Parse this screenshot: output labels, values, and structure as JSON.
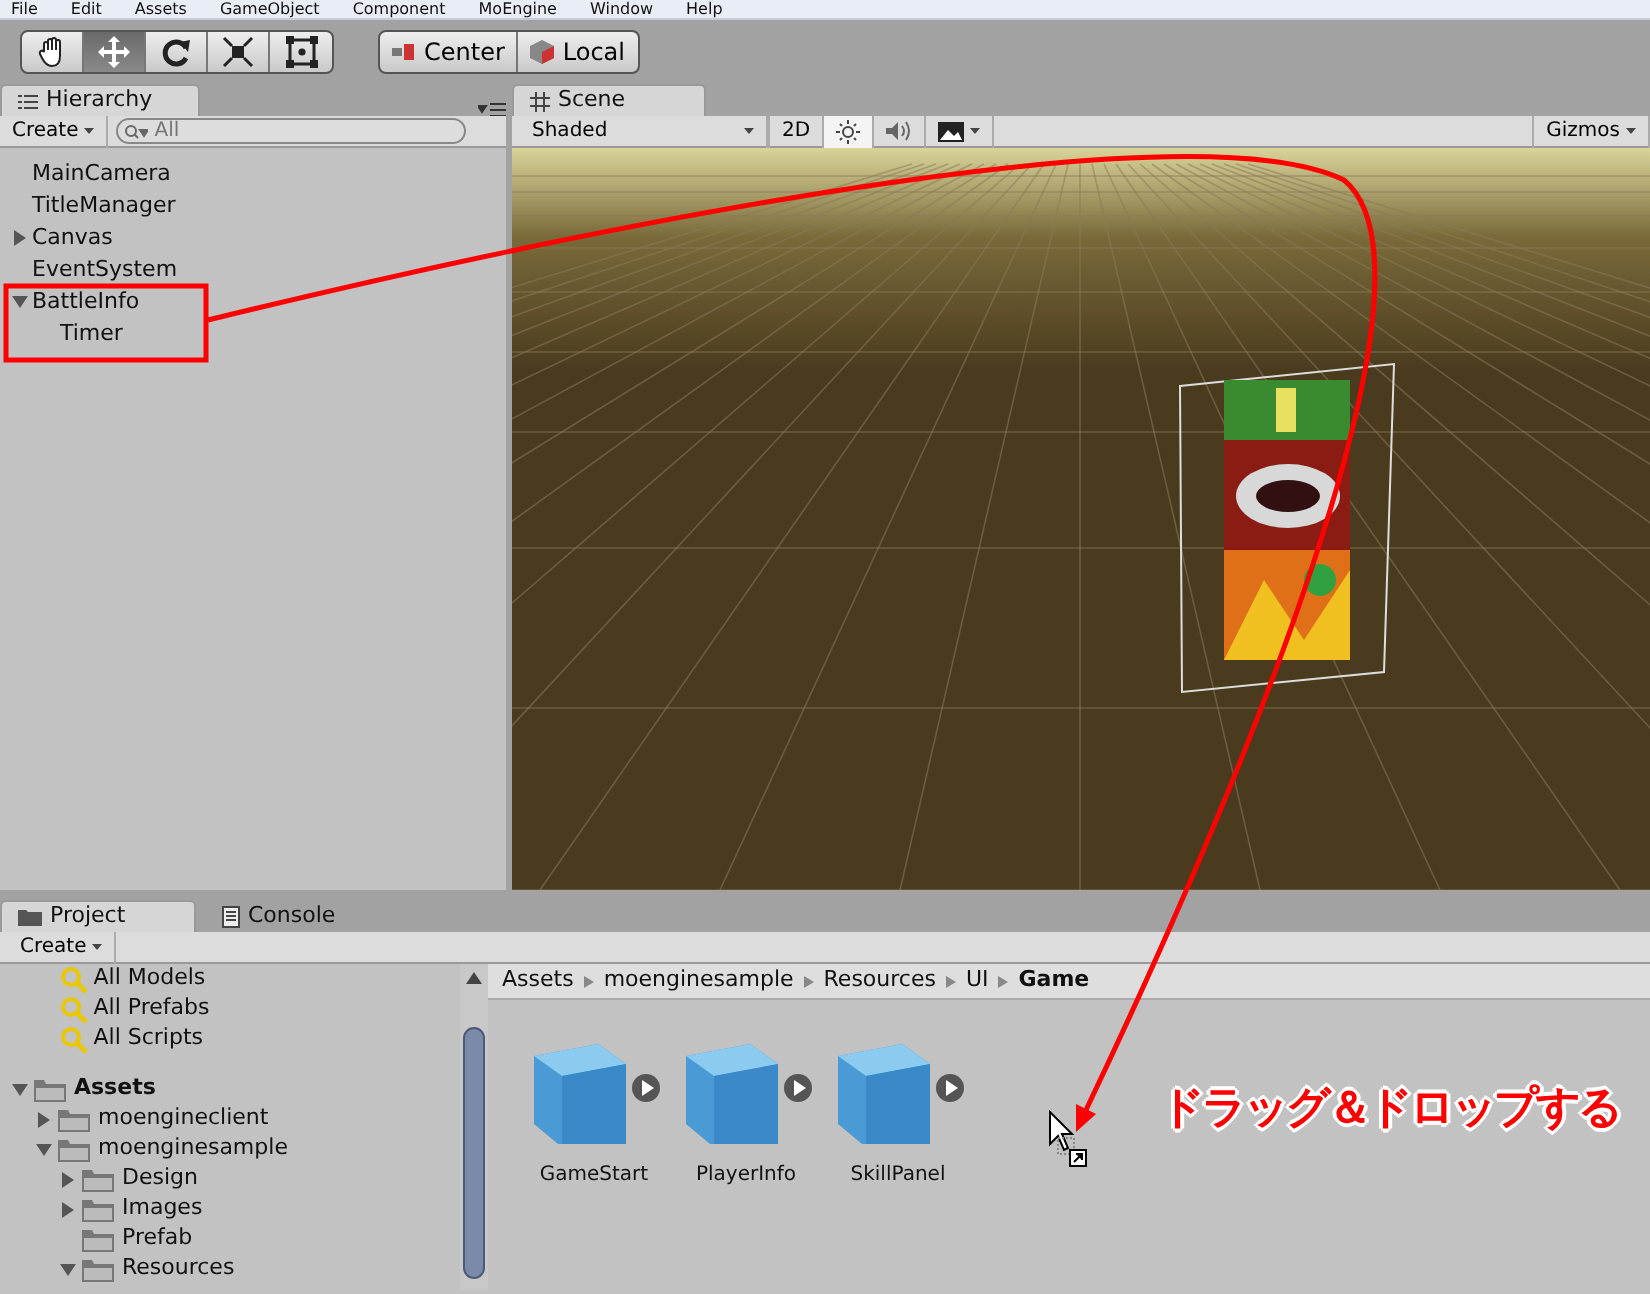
{
  "menu_bar": [
    "File",
    "Edit",
    "Assets",
    "GameObject",
    "Component",
    "MoEngine",
    "Window",
    "Help"
  ],
  "toolbar": {
    "tools": [
      {
        "kind": "hand",
        "selected": false
      },
      {
        "kind": "move",
        "selected": true
      },
      {
        "kind": "rotate",
        "selected": false
      },
      {
        "kind": "scale",
        "selected": false
      },
      {
        "kind": "rect",
        "selected": false
      }
    ],
    "pivot_buttons": [
      {
        "kind": "center",
        "label": "Center"
      },
      {
        "kind": "local",
        "label": "Local"
      }
    ]
  },
  "hierarchy": {
    "tab": "Hierarchy",
    "create": "Create",
    "search": {
      "placeholder": "All"
    },
    "items": [
      {
        "kind": "leaf",
        "label": "MainCamera"
      },
      {
        "kind": "leaf",
        "label": "TitleManager"
      },
      {
        "kind": "group",
        "label": "Canvas",
        "expanded": false
      },
      {
        "kind": "leaf",
        "label": "EventSystem"
      },
      {
        "kind": "group",
        "label": "BattleInfo",
        "expanded": true,
        "children": [
          {
            "kind": "leaf",
            "label": "Timer"
          }
        ]
      }
    ]
  },
  "scene": {
    "tab": "Scene",
    "shading": "Shaded",
    "mode_2d": "2D",
    "lighting_on": true,
    "audio_on": false,
    "gizmos": "Gizmos"
  },
  "project": {
    "tabs": [
      {
        "kind": "project",
        "label": "Project",
        "selected": true
      },
      {
        "kind": "console",
        "label": "Console",
        "selected": false
      }
    ],
    "create": "Create",
    "favorites": [
      "All Models",
      "All Prefabs",
      "All Scripts"
    ],
    "assets": {
      "label": "Assets",
      "expanded": true,
      "children": [
        {
          "label": "moengineclient",
          "kind": "group",
          "expanded": false
        },
        {
          "label": "moenginesample",
          "kind": "group",
          "expanded": true,
          "children": [
            {
              "label": "Design",
              "kind": "group",
              "expanded": false
            },
            {
              "label": "Images",
              "kind": "group",
              "expanded": false
            },
            {
              "label": "Prefab",
              "kind": "leaf"
            },
            {
              "label": "Resources",
              "kind": "group",
              "expanded": true
            }
          ]
        }
      ]
    },
    "breadcrumb": [
      {
        "label": "Assets",
        "current": false
      },
      {
        "label": "moenginesample",
        "current": false
      },
      {
        "label": "Resources",
        "current": false
      },
      {
        "label": "UI",
        "current": false
      },
      {
        "label": "Game",
        "current": true
      }
    ],
    "items": [
      "GameStart",
      "PlayerInfo",
      "SkillPanel"
    ]
  },
  "annotation": "ドラッグ＆ドロップする"
}
